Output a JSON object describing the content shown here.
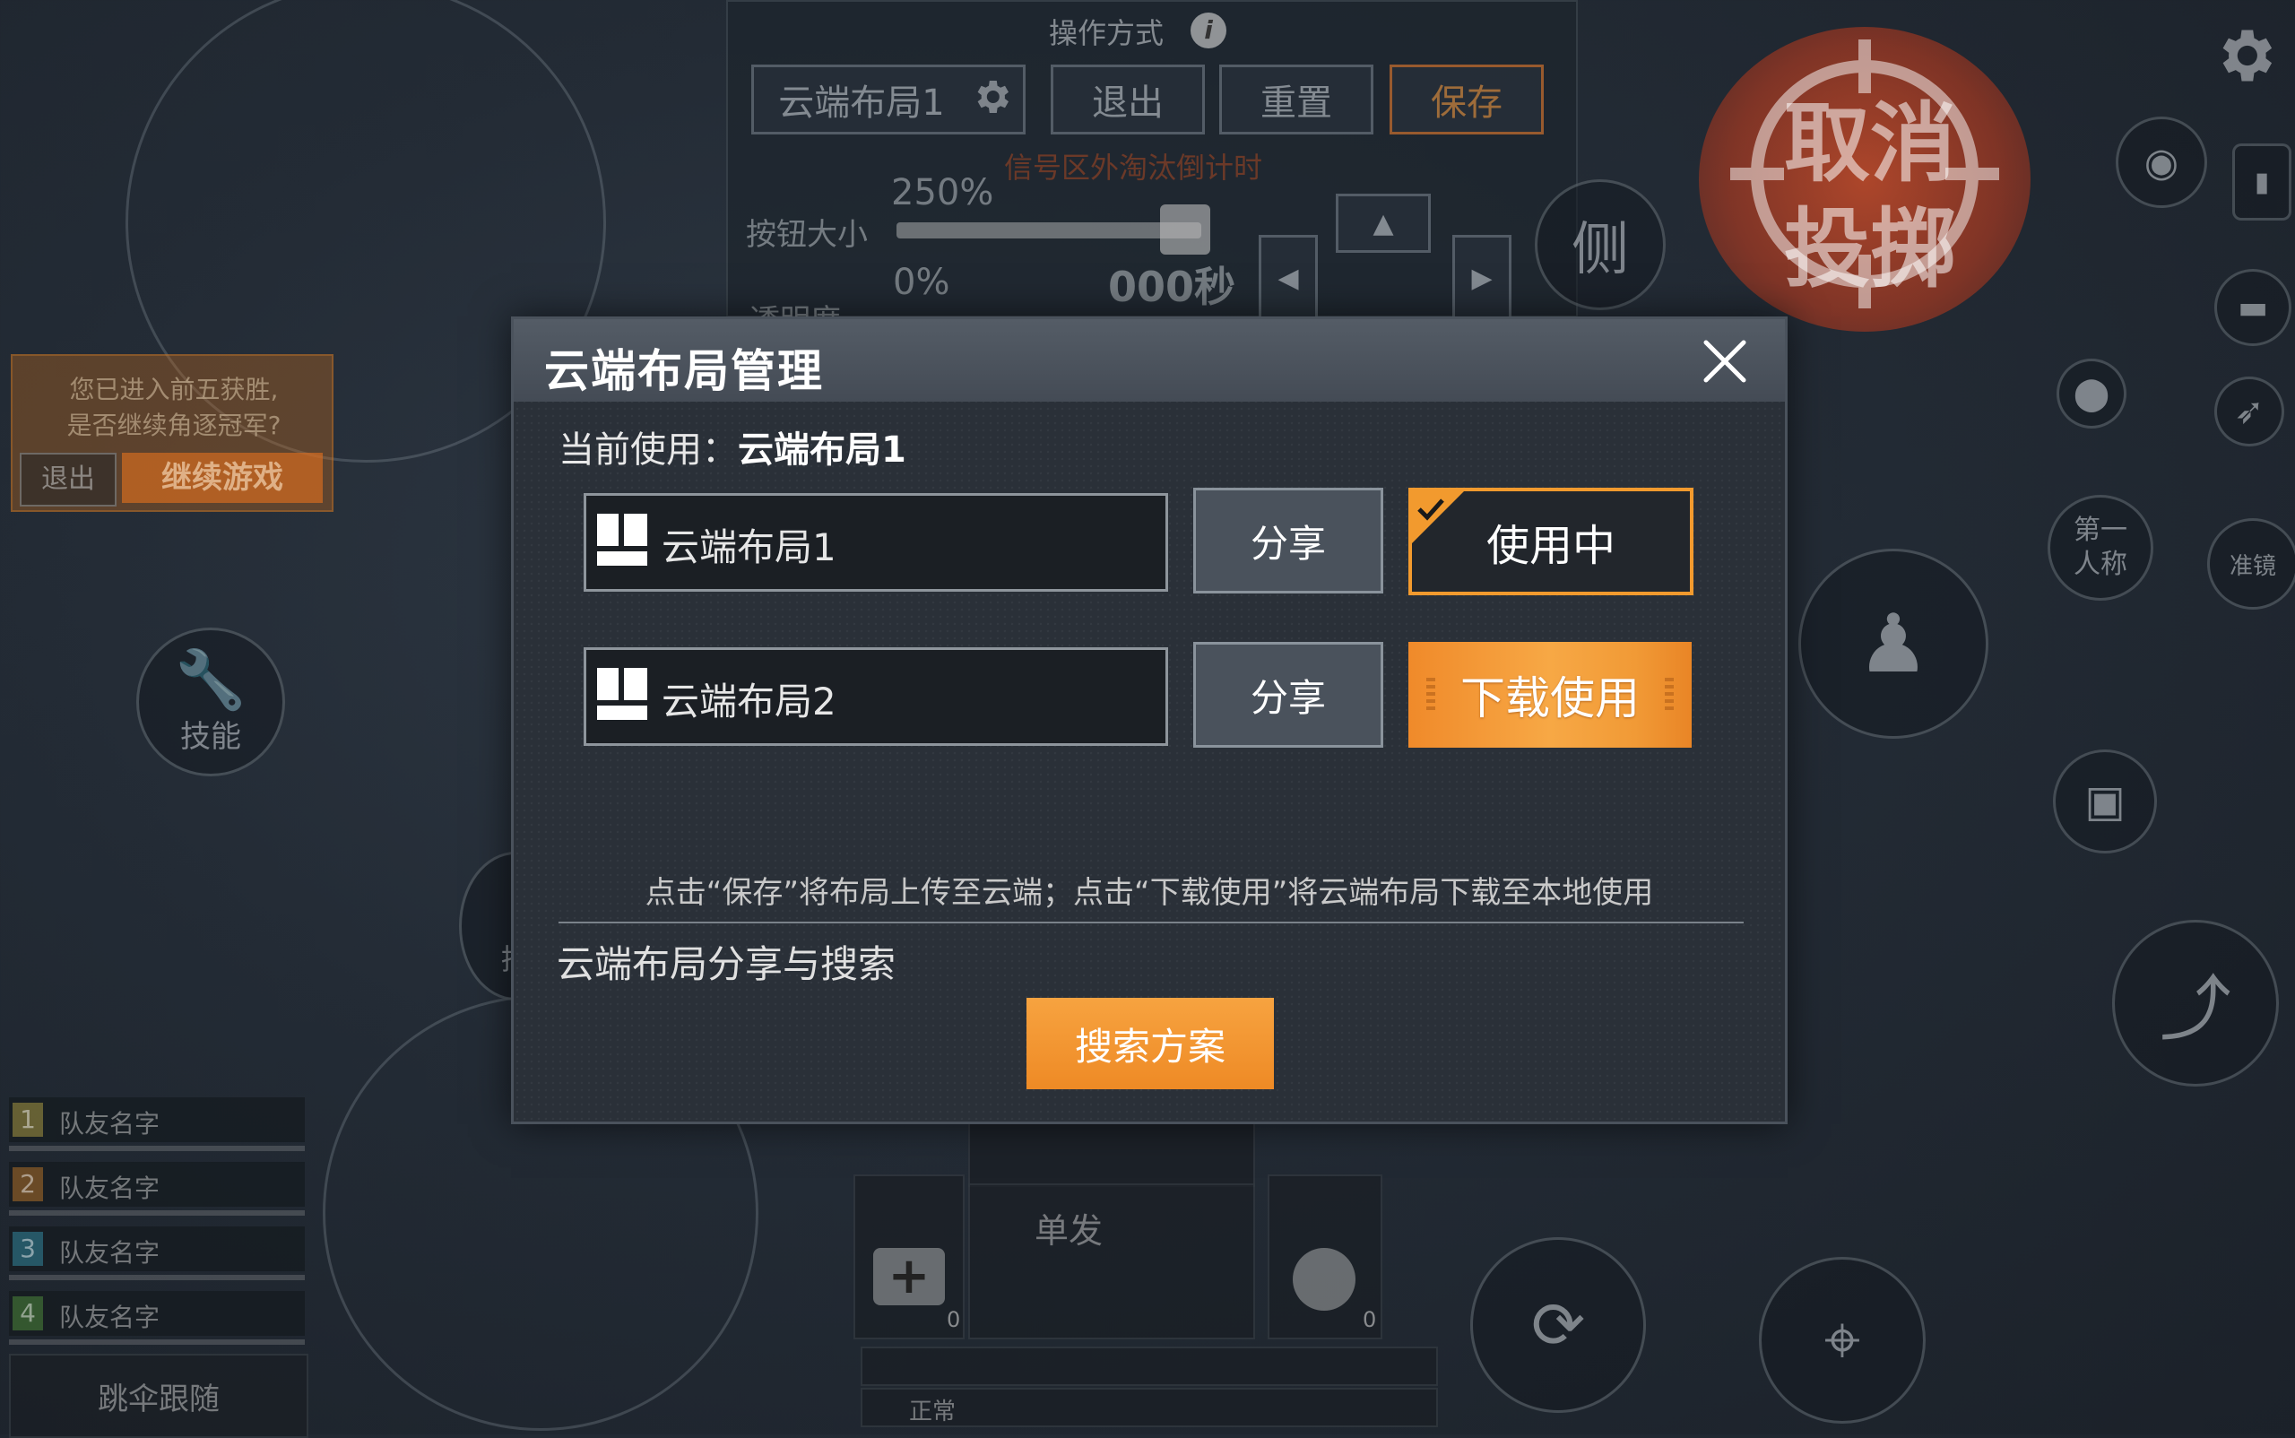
{
  "hud": {
    "op_title": "操作方式",
    "info_icon": "i",
    "layout_select": "云端布局1",
    "exit_btn": "退出",
    "reset_btn": "重置",
    "save_btn": "保存",
    "red_hint": "信号区外淘汰倒计时",
    "button_size_label": "按钮大小",
    "button_size_value": "250%",
    "transparency_label": "透明度",
    "transparency_value": "0%",
    "timer": "000秒",
    "side_btn": "侧",
    "cancel_throw_1": "取消",
    "cancel_throw_2": "投掷",
    "first_person_1": "第一",
    "first_person_2": "人称",
    "aim_label": "准镜",
    "skill_label": "技能",
    "hold_label": "持",
    "fire_mode": "单发",
    "medkit_count": "0",
    "grenade_count": "0",
    "status_label": "正常",
    "parachute_follow": "跳伞跟随",
    "victory_line1": "您已进入前五获胜,",
    "victory_line2": "是否继续角逐冠军?",
    "victory_exit": "退出",
    "victory_continue": "继续游戏",
    "team": [
      {
        "num": "1",
        "name": "队友名字",
        "color": "#c8b44a"
      },
      {
        "num": "2",
        "name": "队友名字",
        "color": "#d0822a"
      },
      {
        "num": "3",
        "name": "队友名字",
        "color": "#3aa0b8"
      },
      {
        "num": "4",
        "name": "队友名字",
        "color": "#58a040"
      }
    ]
  },
  "modal": {
    "title": "云端布局管理",
    "current_label": "当前使用：",
    "current_value": "云端布局1",
    "layouts": [
      {
        "name": "云端布局1",
        "share": "分享",
        "action": "使用中",
        "state": "in-use"
      },
      {
        "name": "云端布局2",
        "share": "分享",
        "action": "下载使用",
        "state": "download"
      }
    ],
    "hint": "点击“保存”将布局上传至云端；点击“下载使用”将云端布局下载至本地使用",
    "section_title": "云端布局分享与搜索",
    "search_btn": "搜索方案"
  },
  "colors": {
    "accent_orange": "#f29a2e",
    "modal_bg": "#2a3038",
    "header_bg": "#4c545e"
  }
}
